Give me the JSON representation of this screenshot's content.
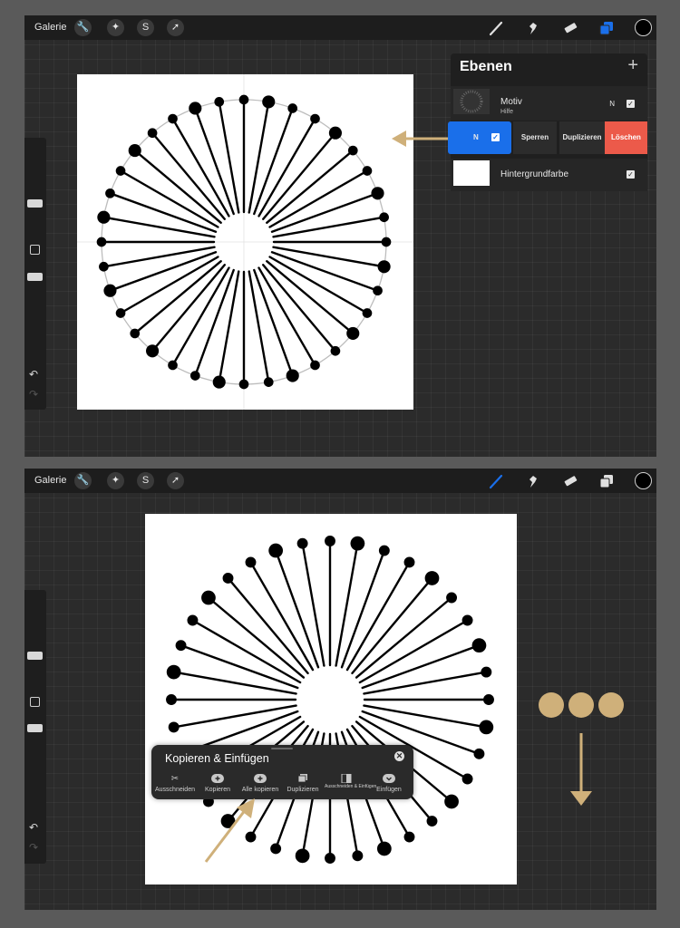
{
  "colors": {
    "accent_blue": "#1a6fea",
    "delete_red": "#ec5a4a",
    "annotation_gold": "#cfb07a"
  },
  "top": {
    "toolbar": {
      "gallery_label": "Galerie",
      "tool_icons": [
        "wrench-icon",
        "magic-wand-icon",
        "selection-s-icon",
        "arrow-icon"
      ],
      "right_icons": [
        "brush-icon",
        "smudge-icon",
        "eraser-icon",
        "layers-icon",
        "color-icon"
      ]
    },
    "layers_panel": {
      "title": "Ebenen",
      "add_label": "+",
      "layer_motiv": {
        "name": "Motiv",
        "sub": "Hilfe",
        "mode": "N"
      },
      "swiped_layer": {
        "mode": "N",
        "actions": [
          "Sperren",
          "Duplizieren",
          "Löschen"
        ]
      },
      "background": {
        "name": "Hintergrundfarbe"
      }
    }
  },
  "bottom": {
    "toolbar": {
      "gallery_label": "Galerie"
    },
    "copy_panel": {
      "title": "Kopieren & Einfügen",
      "buttons": [
        {
          "label": "Ausschneiden",
          "icon": "scissors-icon"
        },
        {
          "label": "Kopieren",
          "icon": "plus-icon"
        },
        {
          "label": "Alle kopieren",
          "icon": "plus-icon"
        },
        {
          "label": "Duplizieren",
          "icon": "duplicate-icon"
        },
        {
          "label": "Ausschneiden & Einfügen",
          "icon": "cut-paste-icon"
        },
        {
          "label": "Einfügen",
          "icon": "paste-icon"
        }
      ]
    }
  }
}
